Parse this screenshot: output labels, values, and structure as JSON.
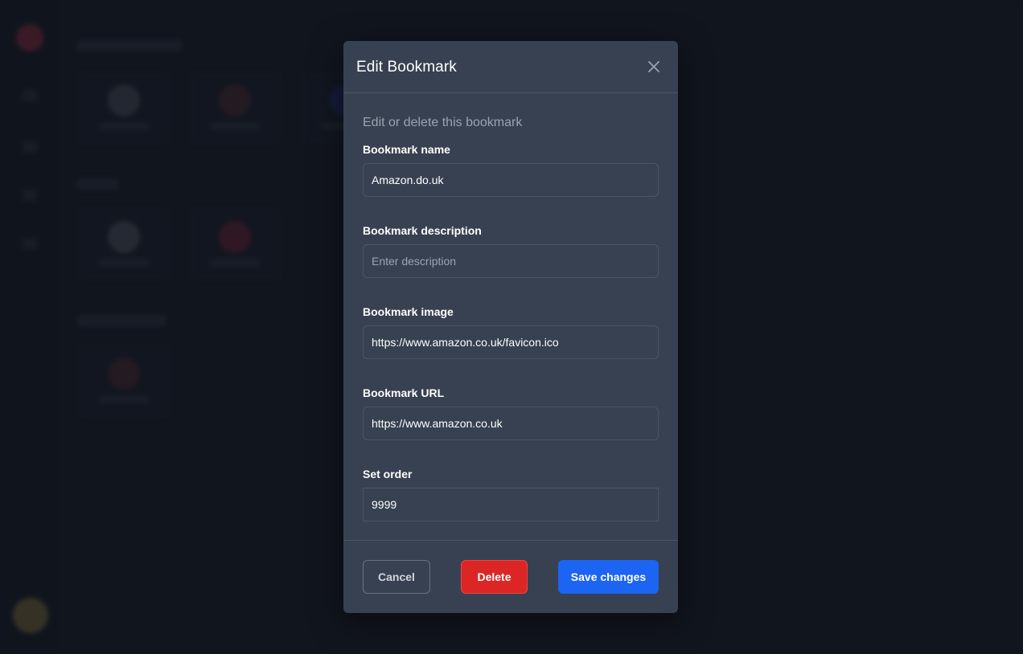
{
  "modal": {
    "title": "Edit Bookmark",
    "description": "Edit or delete this bookmark",
    "fields": {
      "name": {
        "label": "Bookmark name",
        "value": "Amazon.do.uk",
        "placeholder": ""
      },
      "description": {
        "label": "Bookmark description",
        "value": "",
        "placeholder": "Enter description"
      },
      "image": {
        "label": "Bookmark image",
        "value": "https://www.amazon.co.uk/favicon.ico",
        "placeholder": ""
      },
      "url": {
        "label": "Bookmark URL",
        "value": "https://www.amazon.co.uk",
        "placeholder": ""
      },
      "order": {
        "label": "Set order",
        "value": "9999",
        "placeholder": ""
      }
    },
    "buttons": {
      "cancel": "Cancel",
      "delete": "Delete",
      "save": "Save changes"
    }
  },
  "colors": {
    "page_background": "#161b26",
    "modal_background": "#374151",
    "delete": "#dc2626",
    "save": "#1c64f2"
  },
  "icons": {
    "close": "close-icon"
  }
}
